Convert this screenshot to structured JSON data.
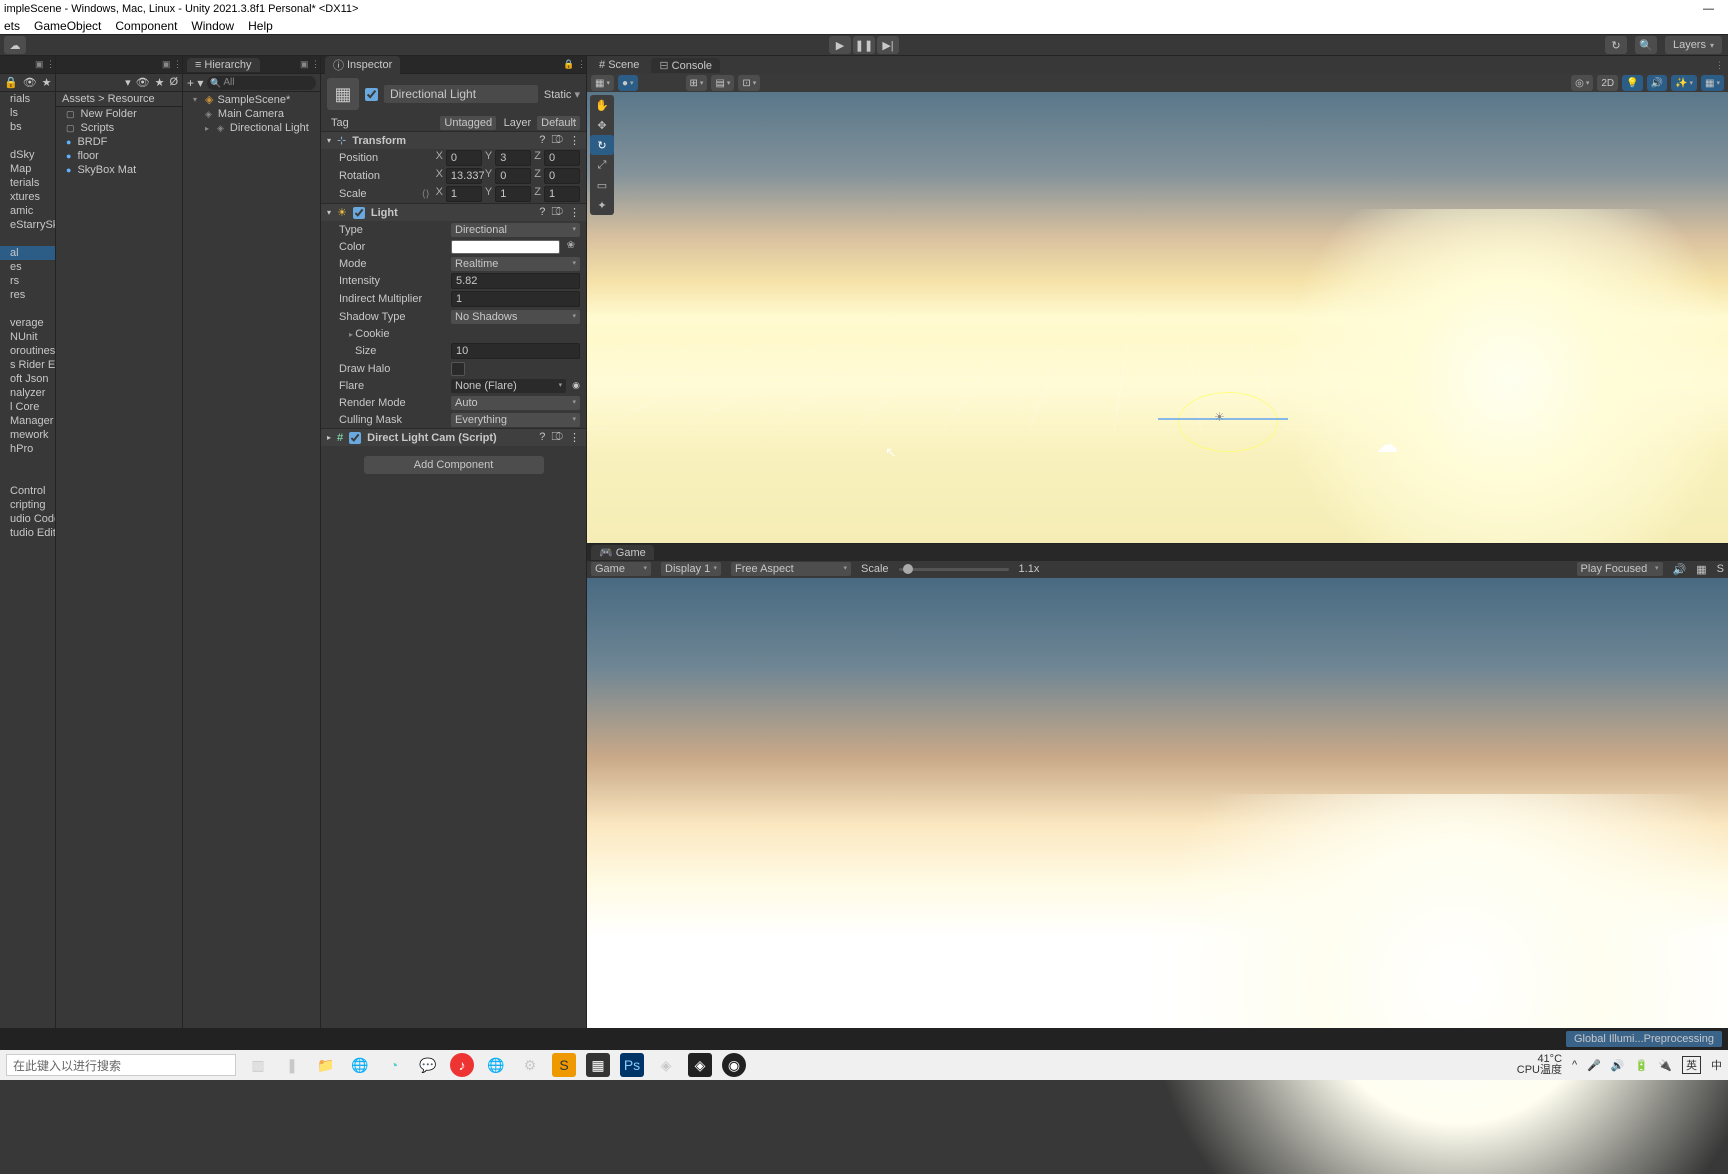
{
  "title": "impleScene - Windows, Mac, Linux - Unity 2021.3.8f1 Personal* <DX11>",
  "menu": [
    "ets",
    "GameObject",
    "Component",
    "Window",
    "Help"
  ],
  "toolbar": {
    "layers": "Layers"
  },
  "project": {
    "items_left": [
      "rials",
      "ls",
      "bs",
      "",
      "dSky",
      "Map",
      "terials",
      "xtures",
      "amic",
      "eStarrySky",
      "",
      "al",
      "es",
      "rs",
      "res",
      "",
      "verage",
      "NUnit",
      "oroutines",
      "s Rider Edito",
      "oft Json",
      "nalyzer",
      "l Core",
      "Manager",
      "mework",
      "hPro",
      "",
      "",
      "Control",
      "cripting",
      "udio Code E",
      "tudio Editor"
    ]
  },
  "assets": {
    "breadcrumb": [
      "Assets",
      "Resource"
    ],
    "items": [
      {
        "label": "New Folder",
        "type": "folder"
      },
      {
        "label": "Scripts",
        "type": "folder"
      },
      {
        "label": "BRDF",
        "type": "mat"
      },
      {
        "label": "floor",
        "type": "mat"
      },
      {
        "label": "SkyBox Mat",
        "type": "mat"
      }
    ]
  },
  "hierarchy": {
    "tab": "Hierarchy",
    "search_ph": "All",
    "scene": "SampleScene*",
    "items": [
      "Main Camera",
      "Directional Light"
    ]
  },
  "inspector": {
    "tab": "Inspector",
    "name": "Directional Light",
    "static": "Static",
    "tag_label": "Tag",
    "tag": "Untagged",
    "layer_label": "Layer",
    "layer": "Default",
    "transform": {
      "title": "Transform",
      "pos_l": "Position",
      "px": "0",
      "py": "3",
      "pz": "0",
      "rot_l": "Rotation",
      "rx": "13.337",
      "ry": "0",
      "rz": "0",
      "scl_l": "Scale",
      "sx": "1",
      "sy": "1",
      "sz": "1"
    },
    "light": {
      "title": "Light",
      "type_l": "Type",
      "type": "Directional",
      "color_l": "Color",
      "mode_l": "Mode",
      "mode": "Realtime",
      "intensity_l": "Intensity",
      "intensity": "5.82",
      "indirect_l": "Indirect Multiplier",
      "indirect": "1",
      "shadow_l": "Shadow Type",
      "shadow": "No Shadows",
      "cookie_l": "Cookie",
      "size_l": "Size",
      "size": "10",
      "halo_l": "Draw Halo",
      "flare_l": "Flare",
      "flare": "None (Flare)",
      "render_l": "Render Mode",
      "render": "Auto",
      "cull_l": "Culling Mask",
      "cull": "Everything"
    },
    "script": {
      "title": "Direct Light Cam (Script)"
    },
    "add": "Add Component"
  },
  "scene": {
    "tab": "Scene",
    "tab2": "Console",
    "btn2d": "2D"
  },
  "game": {
    "tab": "Game",
    "mode": "Game",
    "display": "Display 1",
    "aspect": "Free Aspect",
    "scale_l": "Scale",
    "scale": "1.1x",
    "focus": "Play Focused"
  },
  "status": "Global Illumi...Preprocessing",
  "taskbar": {
    "search": "在此键入以进行搜索",
    "temp": "41°C",
    "cpu": "CPU温度",
    "lang": "英",
    "ime": "中"
  }
}
